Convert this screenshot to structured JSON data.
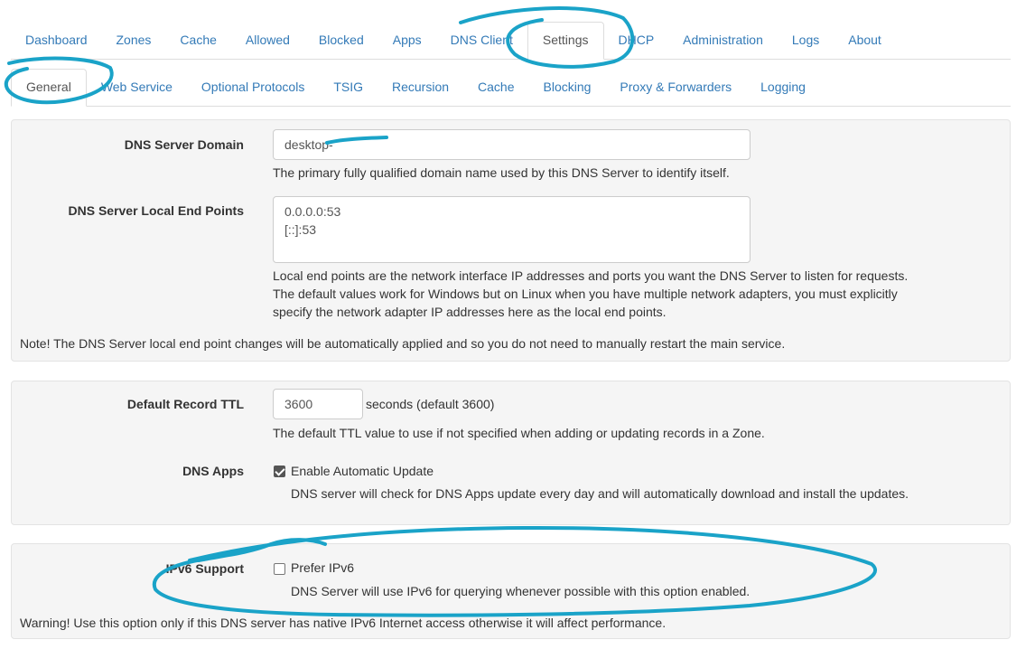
{
  "nav": {
    "tabs": [
      "Dashboard",
      "Zones",
      "Cache",
      "Allowed",
      "Blocked",
      "Apps",
      "DNS Client",
      "Settings",
      "DHCP",
      "Administration",
      "Logs",
      "About"
    ],
    "active": "Settings"
  },
  "subnav": {
    "tabs": [
      "General",
      "Web Service",
      "Optional Protocols",
      "TSIG",
      "Recursion",
      "Cache",
      "Blocking",
      "Proxy & Forwarders",
      "Logging"
    ],
    "active": "General"
  },
  "panel1": {
    "domain_label": "DNS Server Domain",
    "domain_value": "desktop-",
    "domain_help": "The primary fully qualified domain name used by this DNS Server to identify itself.",
    "endpoints_label": "DNS Server Local End Points",
    "endpoints_value": "0.0.0.0:53\n[::]:53",
    "endpoints_help_1": "Local end points are the network interface IP addresses and ports you want the DNS Server to listen for requests.",
    "endpoints_help_2": "The default values work for Windows but on Linux when you have multiple network adapters, you must explicitly",
    "endpoints_help_3": "specify the network adapter IP addresses here as the local end points.",
    "note": "Note! The DNS Server local end point changes will be automatically applied and so you do not need to manually restart the main service."
  },
  "panel2": {
    "ttl_label": "Default Record TTL",
    "ttl_value": "3600",
    "ttl_suffix": "seconds (default 3600)",
    "ttl_help": "The default TTL value to use if not specified when adding or updating records in a Zone.",
    "apps_label": "DNS Apps",
    "apps_checkbox_label": "Enable Automatic Update",
    "apps_checked": true,
    "apps_help": "DNS server will check for DNS Apps update every day and will automatically download and install the updates."
  },
  "panel3": {
    "ipv6_label": "IPv6 Support",
    "ipv6_checkbox_label": "Prefer IPv6",
    "ipv6_checked": false,
    "ipv6_help": "DNS Server will use IPv6 for querying whenever possible with this option enabled.",
    "warning": "Warning! Use this option only if this DNS server has native IPv6 Internet access otherwise it will affect performance."
  },
  "colors": {
    "link": "#337ab7",
    "annotation": "#1aa3c8",
    "panel_bg": "#f5f5f5"
  }
}
